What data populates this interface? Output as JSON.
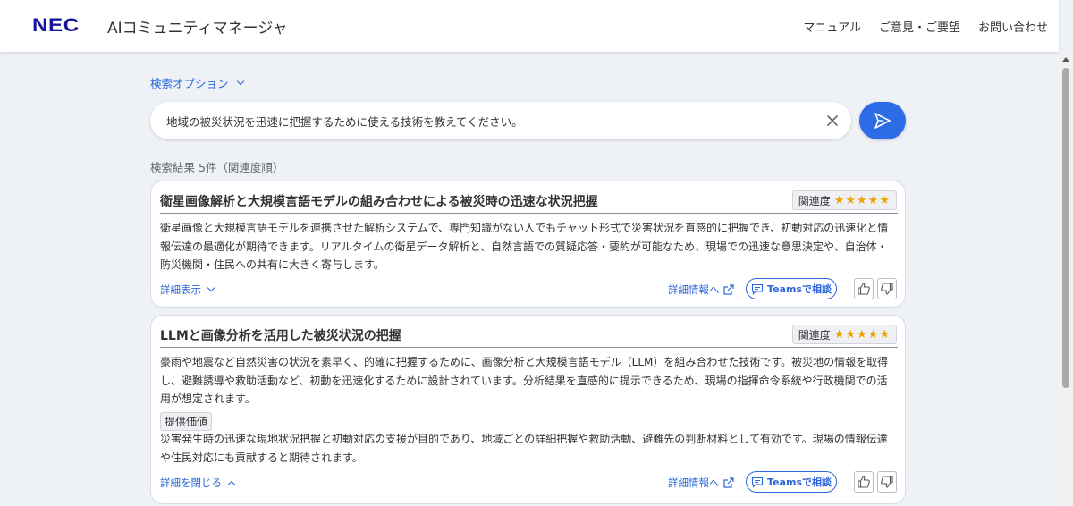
{
  "header": {
    "logo": "NEC",
    "app_title": "AIコミュニティマネージャ",
    "nav": [
      "マニュアル",
      "ご意見・ご要望",
      "お問い合わせ"
    ]
  },
  "search": {
    "options_label": "検索オプション",
    "query": "地域の被災状況を迅速に把握するために使える技術を教えてください。",
    "results_summary": "検索結果 5件（関連度順）"
  },
  "results": [
    {
      "title": "衛星画像解析と大規模言語モデルの組み合わせによる被災時の迅速な状況把握",
      "relevance_label": "関連度",
      "stars": "★★★★★",
      "rating": 5,
      "body": "衛星画像と大規模言語モデルを連携させた解析システムで、専門知識がない人でもチャット形式で災害状況を直感的に把握でき、初動対応の迅速化と情報伝達の最適化が期待できます。リアルタイムの衛星データ解析と、自然言語での質疑応答・要約が可能なため、現場での迅速な意思決定や、自治体・防災機関・住民への共有に大きく寄与します。",
      "toggle_label": "詳細表示",
      "detail_link": "詳細情報へ",
      "teams_label": "Teamsで相談"
    },
    {
      "title": "LLMと画像分析を活用した被災状況の把握",
      "relevance_label": "関連度",
      "stars": "★★★★★",
      "rating": 5,
      "body": "豪雨や地震など自然災害の状況を素早く、的確に把握するために、画像分析と大規模言語モデル（LLM）を組み合わせた技術です。被災地の情報を取得し、避難誘導や救助活動など、初動を迅速化するために設計されています。分析結果を直感的に提示できるため、現場の指揮命令系統や行政機関での活用が想定されます。",
      "value_tag": "提供価値",
      "value_text": "災害発生時の迅速な現地状況把握と初動対応の支援が目的であり、地域ごとの詳細把握や救助活動、避難先の判断材料として有効です。現場の情報伝達や住民対応にも貢献すると期待されます。",
      "toggle_label": "詳細を閉じる",
      "detail_link": "詳細情報へ",
      "teams_label": "Teamsで相談"
    }
  ],
  "colors": {
    "accent": "#2e6be6",
    "link": "#2a66d9",
    "star": "#f0a400",
    "logo": "#1414a0"
  }
}
